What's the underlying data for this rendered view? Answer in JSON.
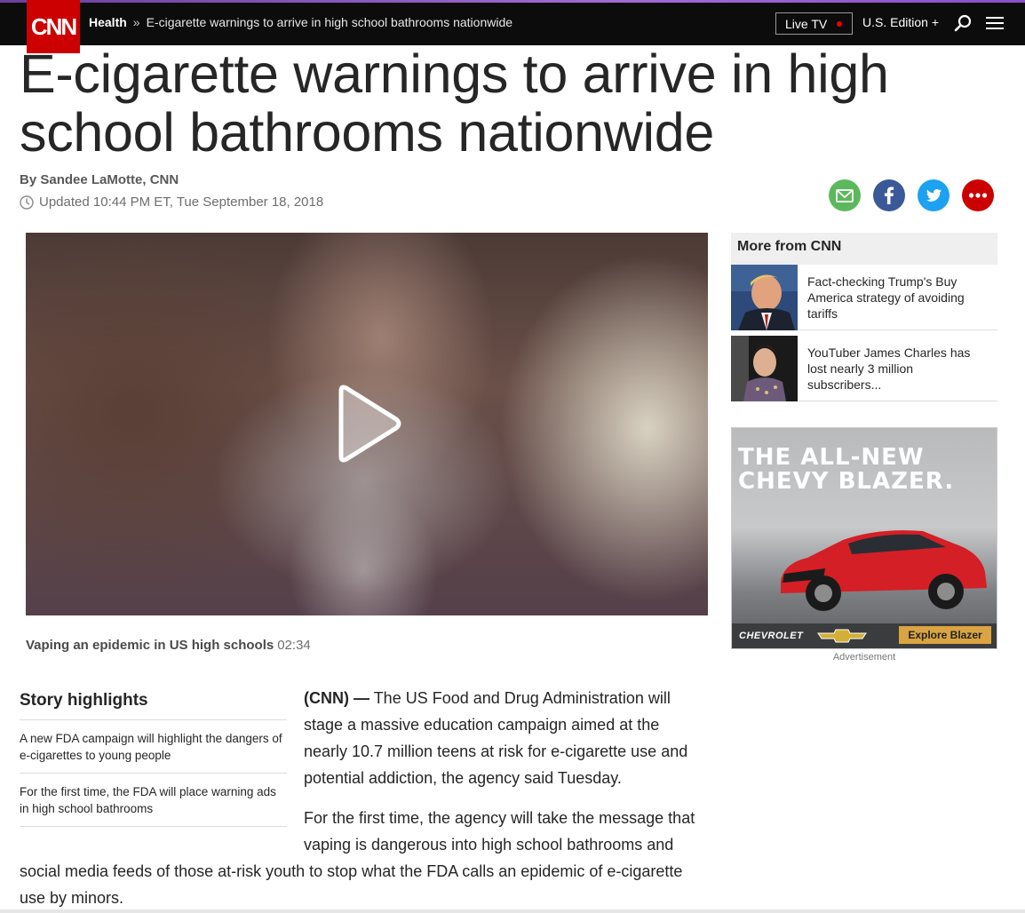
{
  "nav": {
    "logo": "CNN",
    "section": "Health",
    "separator": "»",
    "crumb_title": "E-cigarette warnings to arrive in high school bathrooms nationwide",
    "live_tv": "Live TV",
    "edition": "U.S. Edition +"
  },
  "article": {
    "headline": "E-cigarette warnings to arrive in high school bathrooms nationwide",
    "byline": "By Sandee LaMotte, CNN",
    "updated": "Updated 10:44 PM ET, Tue September 18, 2018"
  },
  "video": {
    "title": "Vaping an epidemic in US high schools",
    "duration": "02:34"
  },
  "sidebar": {
    "title": "More from CNN",
    "items": [
      {
        "text": "Fact-checking Trump's Buy America strategy of avoiding tariffs"
      },
      {
        "text": "YouTuber James Charles has lost nearly 3 million subscribers..."
      }
    ]
  },
  "ad": {
    "headline_line1": "THE ALL-NEW",
    "headline_line2": "CHEVY BLAZER.",
    "brand": "CHEVROLET",
    "cta": "Explore Blazer",
    "label": "Advertisement"
  },
  "highlights": {
    "title": "Story highlights",
    "items": [
      "A new FDA campaign will highlight the dangers of e-cigarettes to young people",
      "For the first time, the FDA will place warning ads in high school bathrooms"
    ]
  },
  "body": {
    "lead": "(CNN) —",
    "p1": "The US Food and Drug Administration will stage a massive education campaign aimed at the nearly 10.7 million teens at risk for e-cigarette use and potential addiction, the agency said Tuesday.",
    "p2_line1": "For the first time, the agency will take the message that",
    "p2_line2": "vaping is dangerous into high school bathrooms and",
    "p2_rest": "social media feeds of those at-risk youth to stop what the FDA calls an epidemic of e-cigarette use by minors."
  },
  "colors": {
    "brand_red": "#cc0000",
    "nav_bg": "#0c0c0c",
    "email": "#5cb85c",
    "facebook": "#3b5998",
    "twitter": "#1da1f2",
    "more": "#cc0000"
  }
}
